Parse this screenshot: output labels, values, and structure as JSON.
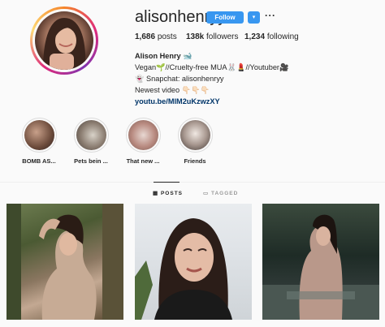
{
  "profile": {
    "username": "alisonhenryy",
    "follow_label": "Follow",
    "dropdown_glyph": "▾",
    "more_glyph": "···",
    "posts_count": "1,686",
    "posts_label": "posts",
    "followers_count": "138k",
    "followers_label": "followers",
    "following_count": "1,234",
    "following_label": "following"
  },
  "bio": {
    "name": "Alison Henry 🐋",
    "line1": "Vegan🌱//Cruelty-free MUA🐰💄//Youtuber🎥",
    "line2": "👻 Snapchat: alisonhenryy",
    "line3": "Newest video 👇🏻👇🏻👇🏻",
    "link": "youtu.be/MlM2uKzwzXY"
  },
  "highlights": [
    {
      "label": "BOMB AS..."
    },
    {
      "label": "Pets bein ..."
    },
    {
      "label": "That new ..."
    },
    {
      "label": "Friends"
    }
  ],
  "tabs": {
    "posts": "POSTS",
    "tagged": "TAGGED"
  },
  "colors": {
    "accent": "#3897f0",
    "link": "#003569"
  }
}
